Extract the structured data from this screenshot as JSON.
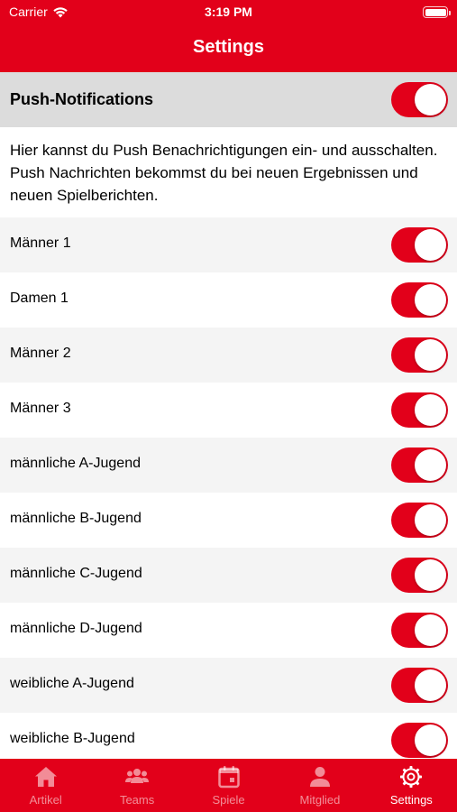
{
  "status": {
    "carrier": "Carrier",
    "time": "3:19 PM"
  },
  "nav": {
    "title": "Settings"
  },
  "push": {
    "label": "Push-Notifications",
    "enabled": true
  },
  "description": "Hier kannst du Push Benachrichtigungen ein- und ausschalten. Push Nachrichten bekommst du bei neuen Ergebnissen und neuen Spielberichten.",
  "teams": [
    {
      "label": "Männer 1",
      "enabled": true
    },
    {
      "label": "Damen 1",
      "enabled": true
    },
    {
      "label": "Männer 2",
      "enabled": true
    },
    {
      "label": "Männer 3",
      "enabled": true
    },
    {
      "label": "männliche A-Jugend",
      "enabled": true
    },
    {
      "label": "männliche B-Jugend",
      "enabled": true
    },
    {
      "label": "männliche C-Jugend",
      "enabled": true
    },
    {
      "label": "männliche D-Jugend",
      "enabled": true
    },
    {
      "label": "weibliche A-Jugend",
      "enabled": true
    },
    {
      "label": "weibliche B-Jugend",
      "enabled": true
    }
  ],
  "tabs": [
    {
      "label": "Artikel",
      "icon": "home-icon",
      "active": false
    },
    {
      "label": "Teams",
      "icon": "group-icon",
      "active": false
    },
    {
      "label": "Spiele",
      "icon": "calendar-icon",
      "active": false
    },
    {
      "label": "Mitglied",
      "icon": "person-icon",
      "active": false
    },
    {
      "label": "Settings",
      "icon": "gear-icon",
      "active": true
    }
  ],
  "colors": {
    "brand": "#e2001a",
    "header_row": "#dcdcdc",
    "row_alt": "#f4f4f4"
  }
}
